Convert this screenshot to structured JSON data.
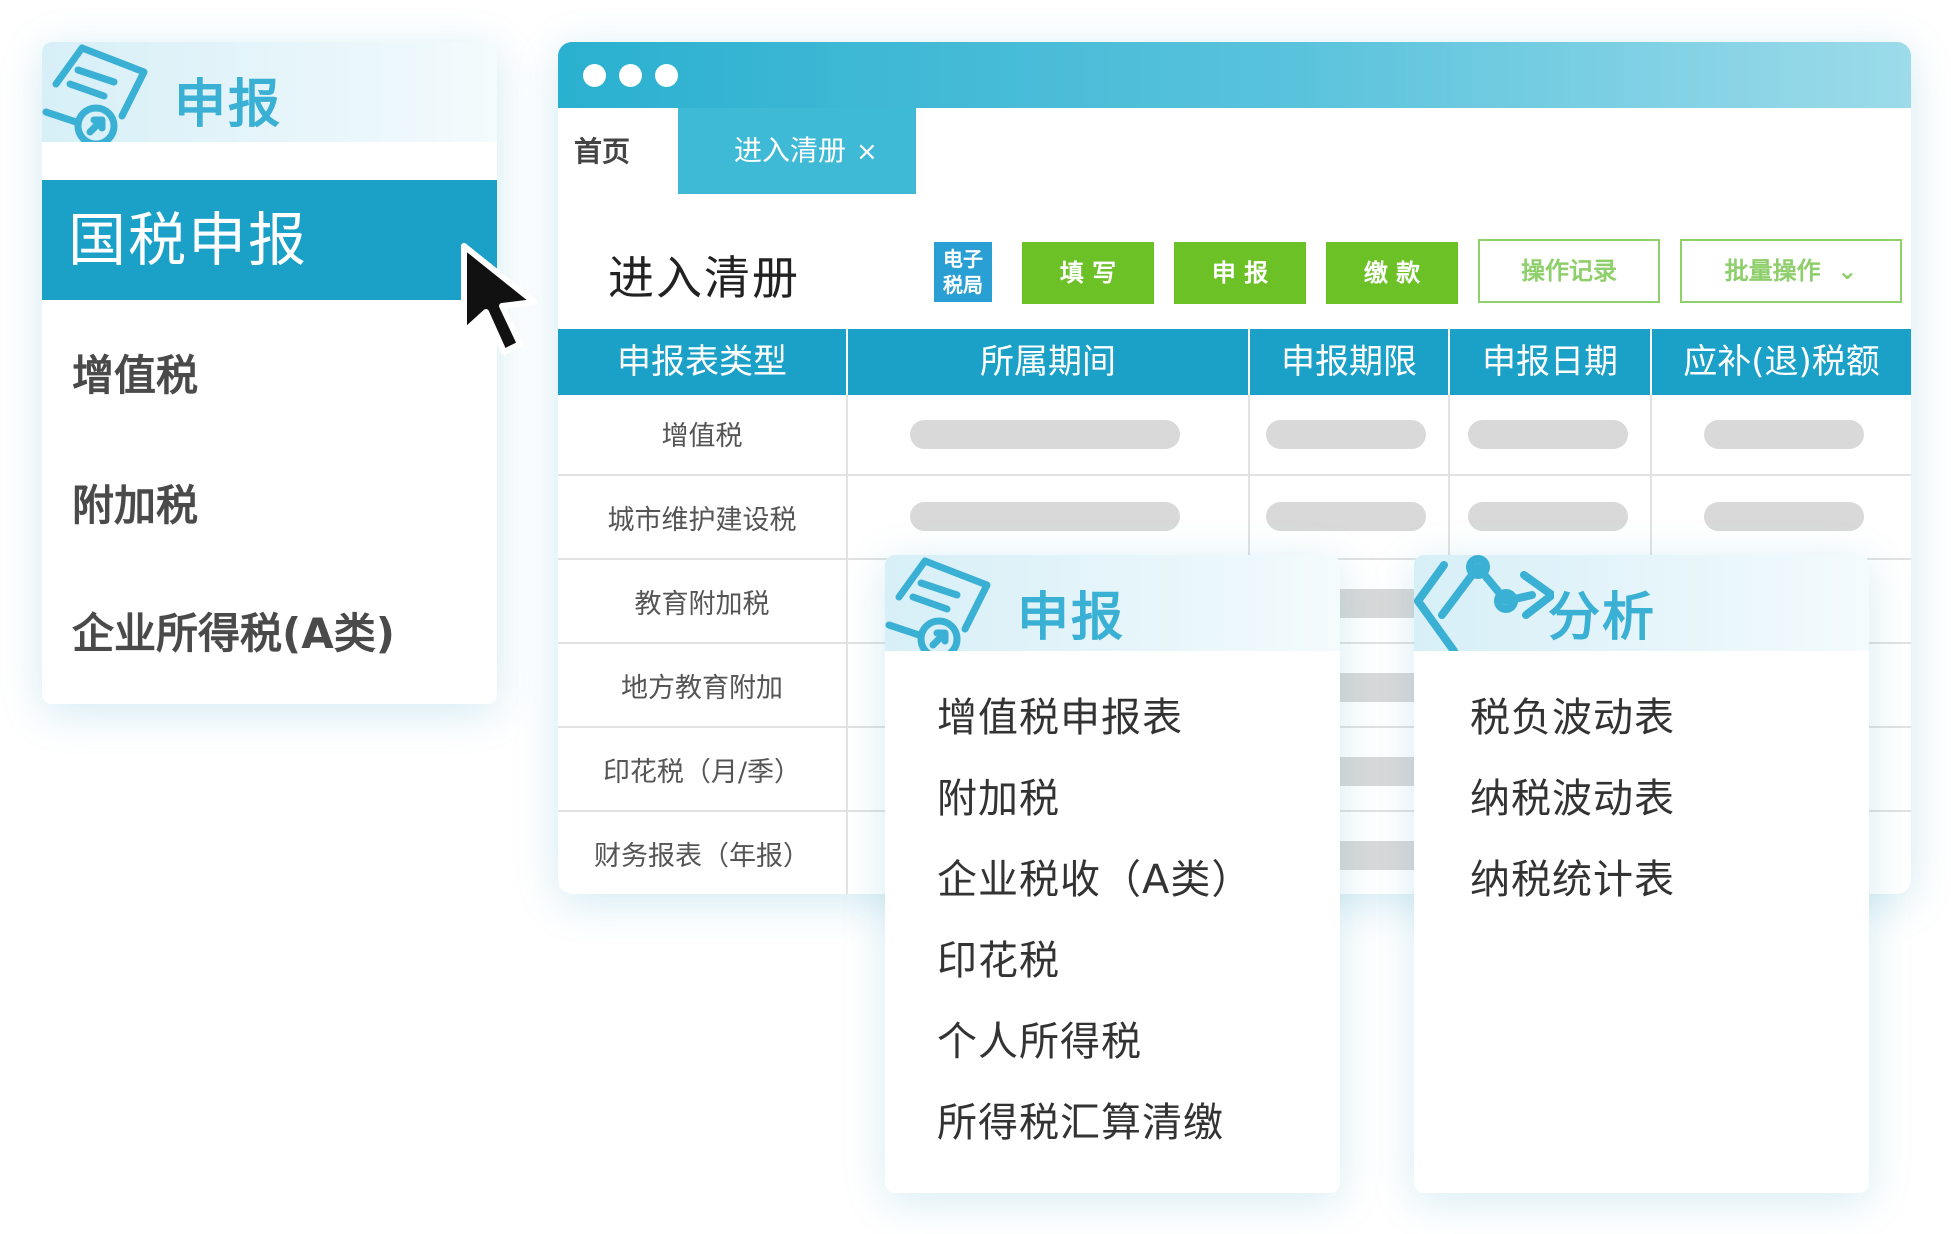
{
  "left_panel": {
    "title": "申报",
    "active_item": "国税申报",
    "items": [
      "增值税",
      "附加税",
      "企业所得税(A类)"
    ]
  },
  "window": {
    "tabs": {
      "home": "首页",
      "active": "进入清册",
      "close": "×"
    },
    "page_title": "进入清册",
    "etax_icon_text": [
      "电子",
      "税局"
    ],
    "buttons": {
      "fill": "填 写",
      "declare": "申 报",
      "pay": "缴 款",
      "operation_log": "操作记录",
      "batch_ops": "批量操作",
      "batch_ops_caret": "⌄"
    },
    "table": {
      "headers": [
        "申报表类型",
        "所属期间",
        "申报期限",
        "申报日期",
        "应补(退)税额"
      ],
      "rows": [
        "增值税",
        "城市维护建设税",
        "教育附加税",
        "地方教育附加",
        "印花税（月/季）",
        "财务报表（年报）"
      ]
    }
  },
  "declare_menu": {
    "title": "申报",
    "items": [
      "增值税申报表",
      "附加税",
      "企业税收（A类）",
      "印花税",
      "个人所得税",
      "所得税汇算清缴"
    ]
  },
  "analysis_menu": {
    "title": "分析",
    "items": [
      "税负波动表",
      "纳税波动表",
      "纳税统计表"
    ]
  },
  "colors": {
    "primary": "#1ba0c8",
    "tab_active": "#3fbad6",
    "green_button": "#6cc127",
    "outline_button": "#8fd06a",
    "placeholder": "#d9d9d9"
  },
  "icons": [
    "document-icon",
    "chart-analysis-icon",
    "mouse-pointer-icon",
    "close-icon"
  ]
}
